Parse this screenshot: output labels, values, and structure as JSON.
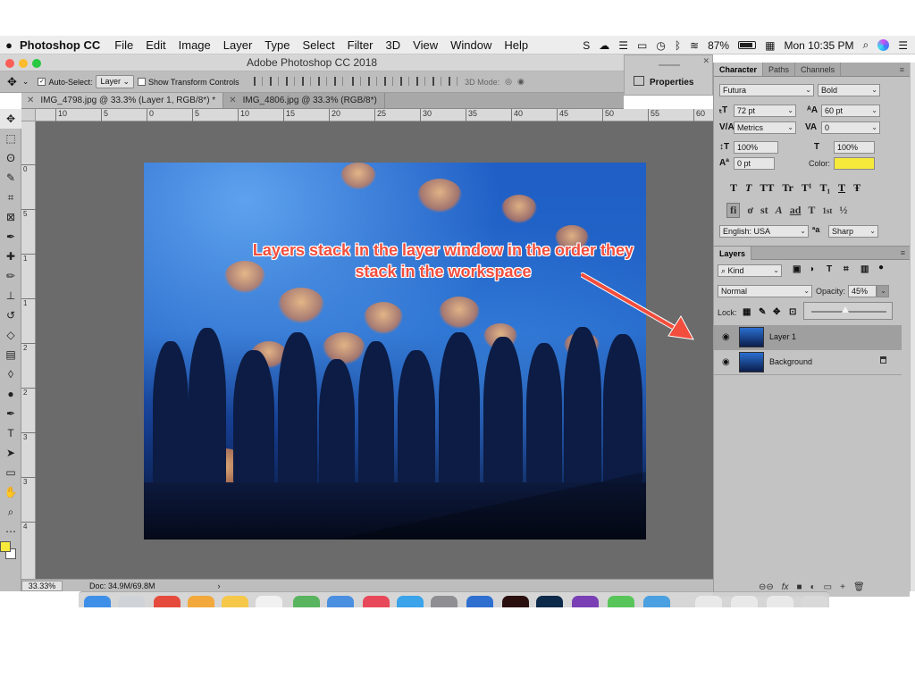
{
  "menubar": {
    "app_name": "Photoshop CC",
    "items": [
      "File",
      "Edit",
      "Image",
      "Layer",
      "Type",
      "Select",
      "Filter",
      "3D",
      "View",
      "Window",
      "Help"
    ],
    "battery": "87%",
    "clock": "Mon 10:35 PM"
  },
  "window": {
    "title": "Adobe Photoshop CC 2018"
  },
  "options": {
    "auto_select_label": "Auto-Select:",
    "auto_select_value": "Layer",
    "transform_label": "Show Transform Controls",
    "mode3d_label": "3D Mode:"
  },
  "tabs": [
    {
      "label": "IMG_4798.jpg @ 33.3% (Layer 1, RGB/8*) *"
    },
    {
      "label": "IMG_4806.jpg @ 33.3% (RGB/8*)"
    }
  ],
  "ruler": {
    "top": [
      "10",
      "5",
      "0",
      "5",
      "10",
      "15",
      "20",
      "25",
      "30",
      "35",
      "40",
      "45",
      "50",
      "55",
      "60"
    ],
    "left": [
      "0",
      "5",
      "1",
      "1",
      "2",
      "2",
      "3",
      "3",
      "4"
    ]
  },
  "callout": {
    "line1": "Layers stack in the layer window in the order they",
    "line2": "stack in the workspace"
  },
  "status": {
    "zoom": "33.33%",
    "doc": "Doc: 34.9M/69.8M"
  },
  "properties": {
    "label": "Properties"
  },
  "character": {
    "tabs": [
      "Character",
      "Paths",
      "Channels"
    ],
    "font": "Futura",
    "style": "Bold",
    "size": "72 pt",
    "leading": "60 pt",
    "kerning": "Metrics",
    "tracking": "0",
    "vscale": "100%",
    "hscale": "100%",
    "baseline": "0 pt",
    "color_label": "Color:",
    "text_color": "#f7e93a",
    "style_buttons": [
      "T",
      "T",
      "TT",
      "Tr",
      "T¹",
      "T₁",
      "T",
      "Ŧ"
    ],
    "opentype_buttons": [
      "fi",
      "ơ",
      "st",
      "A",
      "ad",
      "T",
      "1st",
      "½"
    ],
    "language": "English: USA",
    "antialias": "Sharp"
  },
  "layers": {
    "title": "Layers",
    "filter": "Kind",
    "blend": "Normal",
    "opacity_label": "Opacity:",
    "opacity": "45%",
    "lock_label": "Lock:",
    "items": [
      {
        "name": "Layer 1",
        "selected": true
      },
      {
        "name": "Background",
        "locked": true
      }
    ],
    "footer": [
      "⊖⊖",
      "fx",
      "■",
      "◐",
      "▭",
      "+",
      "🗑"
    ]
  },
  "colors": {
    "accent_callout": "#f24d3d",
    "foreground_swatch": "#f7e93a"
  }
}
